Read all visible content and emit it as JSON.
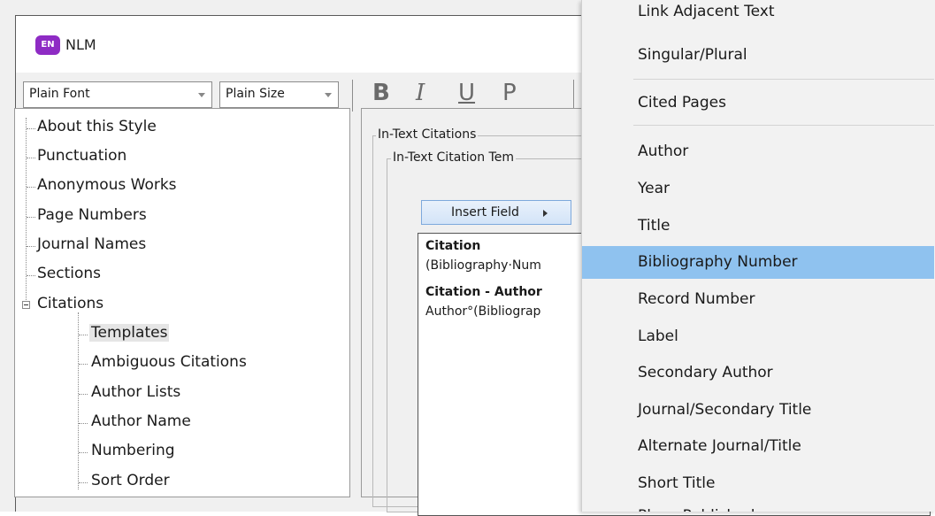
{
  "window": {
    "title": "NLM",
    "logo_text": "EN",
    "logo_color": "#8e2bc4"
  },
  "toolbar": {
    "font_value": "Plain Font",
    "size_value": "Plain Size",
    "bold_label": "B",
    "italic_label": "I",
    "underline_label": "U",
    "plain_label": "P"
  },
  "tree": {
    "items": [
      "About this Style",
      "Punctuation",
      "Anonymous Works",
      "Page Numbers",
      "Journal Names",
      "Sections",
      "Citations"
    ],
    "citations_children": [
      "Templates",
      "Ambiguous Citations",
      "Author Lists",
      "Author Name",
      "Numbering",
      "Sort Order"
    ],
    "selected": "Templates"
  },
  "editor": {
    "group_label": "In-Text Citations",
    "subgroup_label": "In-Text Citation Tem",
    "insert_field_label": "Insert Field",
    "citation_heading": "Citation",
    "citation_template": "(Bibliography·Num",
    "author_heading": "Citation - Author",
    "author_template": "Author°(Bibliograp"
  },
  "menu": {
    "highlight_color": "#8fc2ef",
    "items_top": [
      "Link Adjacent Text",
      "Singular/Plural"
    ],
    "items_middle": [
      "Cited Pages"
    ],
    "items_fields": [
      "Author",
      "Year",
      "Title",
      "Bibliography Number",
      "Record Number",
      "Label",
      "Secondary Author",
      "Journal/Secondary Title",
      "Alternate Journal/Title",
      "Short Title",
      "Place Published"
    ],
    "highlighted": "Bibliography Number"
  }
}
